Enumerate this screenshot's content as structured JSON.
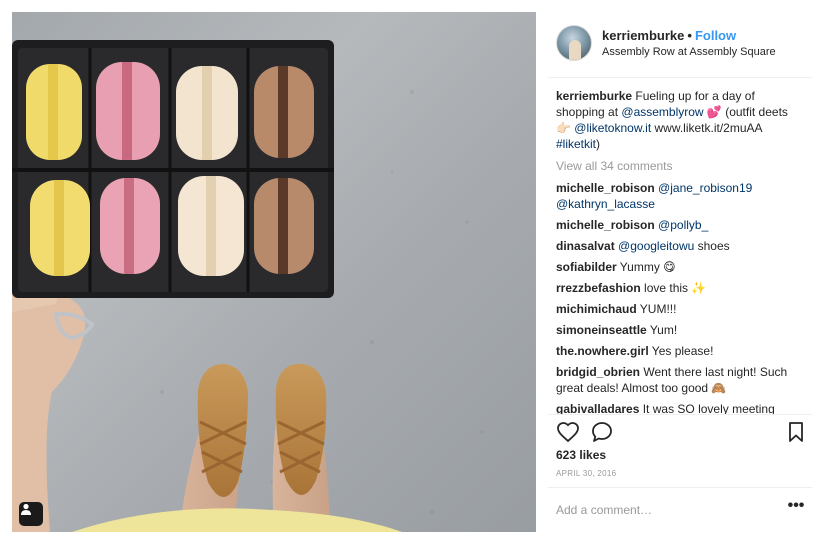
{
  "post": {
    "image_alt": "Photo of a box of macarons held over pavement with lace-up flats",
    "tag_icon": "user-tag-icon"
  },
  "header": {
    "username": "kerriemburke",
    "separator": "•",
    "follow_label": "Follow",
    "location": "Assembly Row at Assembly Square",
    "avatar_icon": "profile-avatar"
  },
  "caption": {
    "username": "kerriemburke",
    "text_1": " Fueling up for a day of shopping at ",
    "mention": "@assemblyrow",
    "text_2": " 💕 (outfit deets 👉🏻 ",
    "mention_2": "@liketoknow.it",
    "text_3": " www.liketk.it/2muAA ",
    "hashtag": "#liketkit",
    "text_4": ")"
  },
  "view_all_label": "View all 34 comments",
  "comments": [
    {
      "user": "michelle_robison",
      "mention": "@jane_robison19 @kathryn_lacasse",
      "text": ""
    },
    {
      "user": "michelle_robison",
      "mention": "@pollyb_",
      "text": ""
    },
    {
      "user": "dinasalvat",
      "mention": "@googleitowu",
      "text": " shoes"
    },
    {
      "user": "sofiabilder",
      "mention": "",
      "text": " Yummy 😋"
    },
    {
      "user": "rrezzbefashion",
      "mention": "",
      "text": " love this ✨"
    },
    {
      "user": "michimichaud",
      "mention": "",
      "text": " YUM!!!"
    },
    {
      "user": "simoneinseattle",
      "mention": "",
      "text": " Yum!"
    },
    {
      "user": "the.nowhere.girl",
      "mention": "",
      "text": " Yes please!"
    },
    {
      "user": "bridgid_obrien",
      "mention": "",
      "text": " Went there last night! Such great deals! Almost too good 🙈"
    },
    {
      "user": "gabivalladares",
      "mention": "",
      "text": " It was SO lovely meeting"
    }
  ],
  "actions": {
    "like_icon": "heart-icon",
    "comment_icon": "comment-bubble-icon",
    "save_icon": "bookmark-icon"
  },
  "likes_label": "623 likes",
  "date_label": "APRIL 30, 2016",
  "add_comment": {
    "placeholder": "Add a comment…",
    "more_label": "•••"
  },
  "colors": {
    "link": "#003569",
    "follow": "#3897f0",
    "muted": "#999999",
    "text": "#262626"
  }
}
